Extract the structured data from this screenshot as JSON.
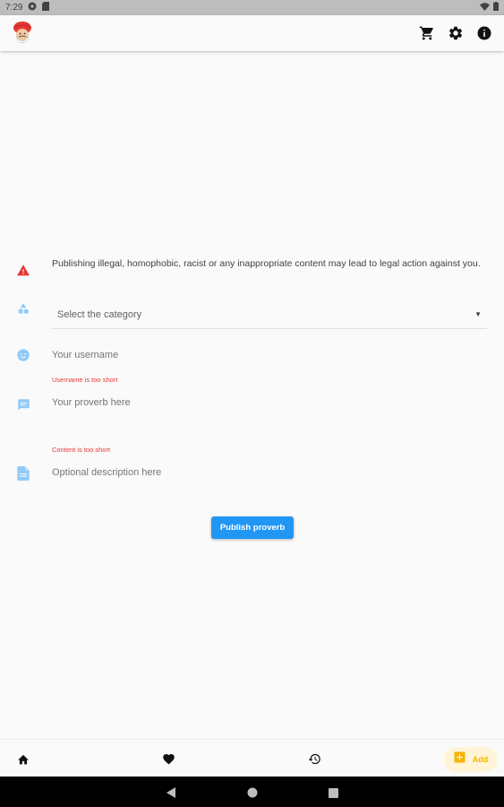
{
  "status_bar": {
    "time": "7:29"
  },
  "app_bar": {
    "avatar_icon": "turban-man-avatar",
    "actions": [
      {
        "icon": "cart-icon"
      },
      {
        "icon": "gear-icon"
      },
      {
        "icon": "info-icon"
      }
    ]
  },
  "form": {
    "warning": "Publishing illegal, homophobic, racist or any inappropriate content may lead to legal action against you.",
    "category_placeholder": "Select the category",
    "username_placeholder": "Your username",
    "username_error": "Username is too short",
    "proverb_placeholder": "Your proverb here",
    "content_error": "Content is too short",
    "description_placeholder": "Optional description here",
    "publish_label": "Publish proverb"
  },
  "bottom_nav": {
    "items": [
      {
        "icon": "home-icon"
      },
      {
        "icon": "heart-icon"
      },
      {
        "icon": "history-icon"
      }
    ],
    "add_label": "Add"
  },
  "colors": {
    "accent": "#2196f3",
    "error": "#e53935",
    "warning_icon": "#e53935",
    "field_icon": "#90caf9",
    "add_accent": "#f5b400",
    "add_bg": "#fff4d6"
  }
}
